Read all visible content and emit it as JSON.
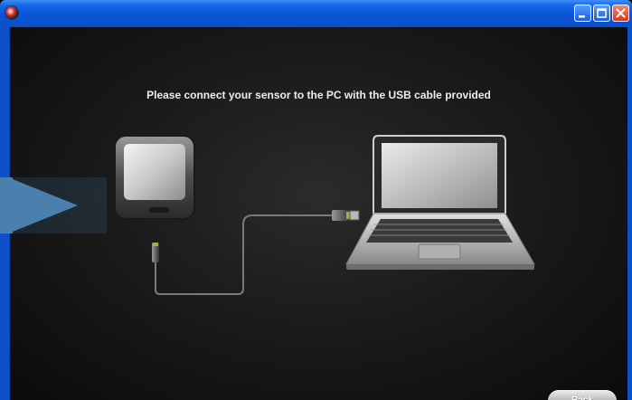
{
  "window": {
    "buttons": {
      "minimize": "minimize-icon",
      "maximize": "maximize-icon",
      "close": "close-icon"
    },
    "titlebar_color": "#0a55d6",
    "close_color": "#d2391b"
  },
  "main": {
    "instruction": "Please connect your sensor to the PC with the USB cable provided",
    "illustration": {
      "sensor": "sensor-device",
      "cable": "usb-cable",
      "computer": "laptop"
    }
  },
  "footer": {
    "back_label": "Back"
  },
  "overlay": {
    "arrow": "play-arrow-icon",
    "arrow_color": "#4a7fae"
  }
}
